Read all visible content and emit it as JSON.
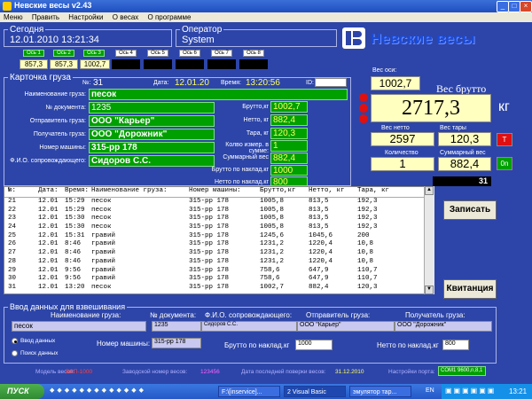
{
  "window": {
    "title": "Невские весы v2.43"
  },
  "menu": [
    "Меню",
    "Править",
    "Настройки",
    "О весах",
    "О программе"
  ],
  "today": {
    "label": "Сегодня",
    "value": "12.01.2010  13:21:34"
  },
  "operator": {
    "label": "Оператор",
    "value": "System"
  },
  "brand": "Невские весы",
  "axles": {
    "labels": [
      "Ось 1",
      "Ось 2",
      "Ось 3",
      "Ось 4",
      "Ось 5",
      "Ось 6",
      "Ось 7",
      "Ось 8"
    ],
    "values": [
      "857,3",
      "857,3",
      "1002,7"
    ]
  },
  "card": {
    "title": "Карточка груза",
    "number_label": "№:",
    "number": "31",
    "date_label": "Дата:",
    "date": "12.01.20",
    "time_label": "Время:",
    "time": "13:20:56",
    "id_label": "ID:",
    "fields": [
      {
        "label": "Наименование груза:",
        "value": "песок"
      },
      {
        "label": "№ документа:",
        "value": "1235"
      },
      {
        "label": "Отправитель груза:",
        "value": "ООО \"Карьер\""
      },
      {
        "label": "Получатель груза:",
        "value": "ООО \"Дорожник\""
      },
      {
        "label": "Номер машины:",
        "value": "315-рр 178"
      },
      {
        "label": "Ф.И.О. сопровождающего:",
        "value": "Сидоров С.С."
      }
    ],
    "right": [
      {
        "label": "Брутто,кг",
        "value": "1002,7"
      },
      {
        "label": "Нетто, кг",
        "value": "882,4"
      },
      {
        "label": "Тара, кг",
        "value": "120,3"
      },
      {
        "label": "Колво измер. в сумме:",
        "value": "1"
      },
      {
        "label": "Суммарный вес",
        "value": "882,4"
      },
      {
        "label": "Брутто по наклад.кг",
        "value": "1000"
      },
      {
        "label": "Нетто по наклад.кг",
        "value": "800"
      }
    ]
  },
  "weights": {
    "axle_label": "Вес оси:",
    "axle_value": "1002,7",
    "gross_label": "Вес брутто",
    "gross_value": "2717,3",
    "gross_unit": "кг",
    "net_label": "Вес нетто",
    "net_value": "2597",
    "tare_label": "Вес тары",
    "tare_value": "120,3",
    "t_button": "T",
    "count_label": "Количество",
    "count_value": "1",
    "sum_label": "Суммарный вес",
    "sum_value": "882,4",
    "on_button": "0n",
    "counter": "31"
  },
  "table": {
    "headers": [
      "№:",
      "Дата:",
      "Время:",
      "Наименование груза:",
      "Номер машины:",
      "Брутто,кг",
      "Нетто, кг",
      "Тара, кг"
    ],
    "rows": [
      [
        "21",
        "12.01",
        "15:29",
        "песок",
        "315-рр 178",
        "1005,8",
        "813,5",
        "192,3"
      ],
      [
        "22",
        "12.01",
        "15:29",
        "песок",
        "315-рр 178",
        "1005,8",
        "813,5",
        "192,3"
      ],
      [
        "23",
        "12.01",
        "15:30",
        "песок",
        "315-рр 178",
        "1005,8",
        "813,5",
        "192,3"
      ],
      [
        "24",
        "12.01",
        "15:30",
        "песок",
        "315-рр 178",
        "1005,8",
        "813,5",
        "192,3"
      ],
      [
        "25",
        "12.01",
        "15:31",
        "гравий",
        "315-рр 178",
        "1245,6",
        "1045,6",
        "200"
      ],
      [
        "26",
        "12.01",
        "8:46",
        "гравий",
        "315-рр 178",
        "1231,2",
        "1220,4",
        "10,8"
      ],
      [
        "27",
        "12.01",
        "8:46",
        "гравий",
        "315-рр 178",
        "1231,2",
        "1220,4",
        "10,8"
      ],
      [
        "28",
        "12.01",
        "8:46",
        "гравий",
        "315-рр 178",
        "1231,2",
        "1220,4",
        "10,8"
      ],
      [
        "29",
        "12.01",
        "9:56",
        "гравий",
        "315-рр 178",
        "758,6",
        "647,9",
        "110,7"
      ],
      [
        "30",
        "12.01",
        "9:56",
        "гравий",
        "315-рр 178",
        "758,6",
        "647,9",
        "110,7"
      ],
      [
        "31",
        "12.01",
        "13:20",
        "песок",
        "315-рр 178",
        "1002,7",
        "882,4",
        "120,3"
      ]
    ]
  },
  "buttons": {
    "record": "Записать",
    "receipt": "Квитанция"
  },
  "input": {
    "title": "Ввод данных для взвешивания",
    "cargo_label": "Наименование груза:",
    "cargo_value": "песок",
    "doc_label": "№ документа:",
    "doc_value": "1235",
    "fio_label": "Ф.И.О. сопровождающего:",
    "fio_value": "Сидоров С.С.",
    "sender_label": "Отправитель груза:",
    "sender_value": "ООО \"Карьер\"",
    "receiver_label": "Получатель груза:",
    "receiver_value": "ООО \"Дорожник\"",
    "radio_enter": "Ввод данных",
    "radio_search": "Поиск данных",
    "car_label": "Номер машины:",
    "car_value": "315-рр 178",
    "gross_label": "Брутто по наклад.кг",
    "gross_value": "1000",
    "net_label": "Нетто по наклад.кг",
    "net_value": "800"
  },
  "status": {
    "model_label": "Модель весов:",
    "model_value": "ВСП-1000",
    "serial_label": "Заводской номер весов:",
    "serial_value": "123456",
    "verify_label": "Дата последней поверки весов:",
    "verify_value": "31.12.2010",
    "port_label": "Настройки порта:",
    "port_value": "COM1  9600,n,8,1"
  },
  "taskbar": {
    "start": "ПУСК",
    "tasks": [
      "F:\\[inservice]...",
      "2 Visual Basic",
      "эмулятор тар..."
    ],
    "lang": "EN",
    "clock": "13:21"
  }
}
